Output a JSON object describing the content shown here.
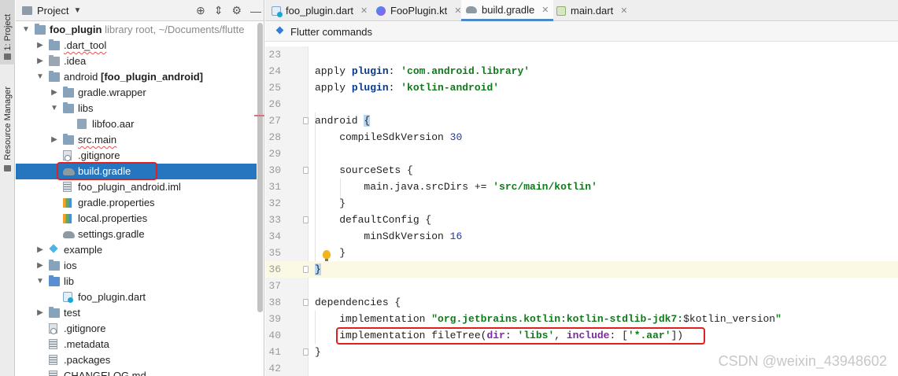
{
  "toolstrip": {
    "project_tab": "1: Project",
    "resource_tab": "Resource Manager"
  },
  "project_panel": {
    "title": "Project",
    "header_icons": [
      "crosshair-icon",
      "collapse-icon",
      "gear-icon",
      "minimize-icon"
    ],
    "tree": [
      {
        "name": "foo_plugin",
        "suffix": "library root, ~/Documents/flutte",
        "type": "folder",
        "indent": 0,
        "expanded": true
      },
      {
        "name": ".dart_tool",
        "type": "folder",
        "indent": 1,
        "expanded": false
      },
      {
        "name": ".idea",
        "type": "folder-idea",
        "indent": 1,
        "expanded": false
      },
      {
        "name": "android",
        "suffix": "[foo_plugin_android]",
        "type": "folder",
        "indent": 1,
        "expanded": true
      },
      {
        "name": "gradle.wrapper",
        "type": "folder",
        "indent": 2,
        "expanded": false
      },
      {
        "name": "libs",
        "type": "folder",
        "indent": 2,
        "expanded": true
      },
      {
        "name": "libfoo.aar",
        "type": "aar",
        "indent": 3
      },
      {
        "name": "src.main",
        "type": "folder",
        "indent": 2,
        "expanded": false
      },
      {
        "name": ".gitignore",
        "type": "gitignore",
        "indent": 2
      },
      {
        "name": "build.gradle",
        "type": "gradle",
        "indent": 2,
        "selected": true
      },
      {
        "name": "foo_plugin_android.iml",
        "type": "file-lines",
        "indent": 2
      },
      {
        "name": "gradle.properties",
        "type": "props",
        "indent": 2
      },
      {
        "name": "local.properties",
        "type": "props",
        "indent": 2
      },
      {
        "name": "settings.gradle",
        "type": "gradle",
        "indent": 2
      },
      {
        "name": "example",
        "type": "flutter",
        "indent": 1,
        "expanded": false
      },
      {
        "name": "ios",
        "type": "folder",
        "indent": 1,
        "expanded": false
      },
      {
        "name": "lib",
        "type": "folder-blue",
        "indent": 1,
        "expanded": true
      },
      {
        "name": "foo_plugin.dart",
        "type": "dart",
        "indent": 2
      },
      {
        "name": "test",
        "type": "folder",
        "indent": 1,
        "expanded": false
      },
      {
        "name": ".gitignore",
        "type": "gitignore",
        "indent": 1
      },
      {
        "name": ".metadata",
        "type": "file-lines",
        "indent": 1
      },
      {
        "name": ".packages",
        "type": "file-lines",
        "indent": 1
      },
      {
        "name": "CHANGELOG.md",
        "type": "file-lines",
        "indent": 1
      }
    ]
  },
  "editor": {
    "tabs": [
      {
        "label": "foo_plugin.dart",
        "icon": "dart-file-icon",
        "active": false
      },
      {
        "label": "FooPlugin.kt",
        "icon": "kotlin-file-icon",
        "active": false
      },
      {
        "label": "build.gradle",
        "icon": "gradle-file-icon",
        "active": true
      },
      {
        "label": "main.dart",
        "icon": "dart-file-icon",
        "active": false
      }
    ],
    "command_bar": "Flutter commands",
    "lines": [
      {
        "n": "23",
        "tokens": []
      },
      {
        "n": "24",
        "tokens": [
          [
            "plain",
            "apply "
          ],
          [
            "kw",
            "plugin"
          ],
          [
            "plain",
            ": "
          ],
          [
            "str",
            "'com.android.library'"
          ]
        ]
      },
      {
        "n": "25",
        "tokens": [
          [
            "plain",
            "apply "
          ],
          [
            "kw",
            "plugin"
          ],
          [
            "plain",
            ": "
          ],
          [
            "str",
            "'kotlin-android'"
          ]
        ]
      },
      {
        "n": "26",
        "tokens": []
      },
      {
        "n": "27",
        "tokens": [
          [
            "plain",
            "android "
          ],
          [
            "brace",
            "{"
          ]
        ]
      },
      {
        "n": "28",
        "tokens": [
          [
            "plain",
            "    compileSdkVersion "
          ],
          [
            "num",
            "30"
          ]
        ]
      },
      {
        "n": "29",
        "tokens": []
      },
      {
        "n": "30",
        "tokens": [
          [
            "plain",
            "    sourceSets {"
          ]
        ]
      },
      {
        "n": "31",
        "tokens": [
          [
            "plain",
            "        main.java.srcDirs += "
          ],
          [
            "str",
            "'src/main/kotlin'"
          ]
        ]
      },
      {
        "n": "32",
        "tokens": [
          [
            "plain",
            "    }"
          ]
        ]
      },
      {
        "n": "33",
        "tokens": [
          [
            "plain",
            "    defaultConfig {"
          ]
        ]
      },
      {
        "n": "34",
        "tokens": [
          [
            "plain",
            "        minSdkVersion "
          ],
          [
            "num",
            "16"
          ]
        ]
      },
      {
        "n": "35",
        "tokens": [
          [
            "plain",
            "    }"
          ]
        ]
      },
      {
        "n": "36",
        "tokens": [
          [
            "brace",
            "}"
          ]
        ]
      },
      {
        "n": "37",
        "tokens": []
      },
      {
        "n": "38",
        "tokens": [
          [
            "plain",
            "dependencies {"
          ]
        ]
      },
      {
        "n": "39",
        "tokens": [
          [
            "plain",
            "    implementation "
          ],
          [
            "str",
            "\"org.jetbrains.kotlin:kotlin-stdlib-jdk7:"
          ],
          [
            "plain",
            "$kotlin_version"
          ],
          [
            "str",
            "\""
          ]
        ]
      },
      {
        "n": "40",
        "tokens": [
          [
            "plain",
            "    implementation fileTree("
          ],
          [
            "kw2",
            "dir"
          ],
          [
            "plain",
            ": "
          ],
          [
            "str",
            "'libs'"
          ],
          [
            "plain",
            ", "
          ],
          [
            "kw2",
            "include"
          ],
          [
            "plain",
            ": ["
          ],
          [
            "str",
            "'*.aar'"
          ],
          [
            "plain",
            "])"
          ]
        ]
      },
      {
        "n": "41",
        "tokens": [
          [
            "plain",
            "}"
          ]
        ]
      },
      {
        "n": "42",
        "tokens": []
      }
    ]
  },
  "watermark": "CSDN @weixin_43948602"
}
